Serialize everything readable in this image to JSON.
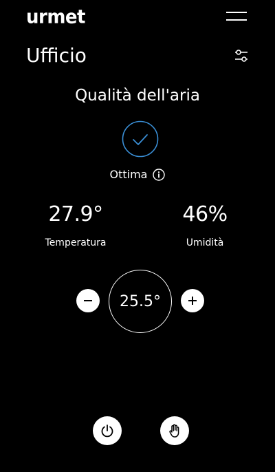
{
  "header": {
    "logo_text": "urmet",
    "menu_icon": "hamburger-menu-icon",
    "room_title": "Ufficio",
    "settings_icon": "sliders-icon"
  },
  "air_quality": {
    "title": "Qualità dell'aria",
    "status_icon": "check-circle-icon",
    "status_label": "Ottima",
    "info_icon": "info-icon",
    "accent_color": "#3a8fd6"
  },
  "readings": {
    "temperature": {
      "value": "27.9°",
      "label": "Temperatura"
    },
    "humidity": {
      "value": "46%",
      "label": "Umidità"
    }
  },
  "setpoint": {
    "value": "25.5°",
    "decrease_icon": "minus-icon",
    "increase_icon": "plus-icon"
  },
  "bottom_actions": {
    "power_icon": "power-icon",
    "manual_icon": "hand-icon"
  }
}
